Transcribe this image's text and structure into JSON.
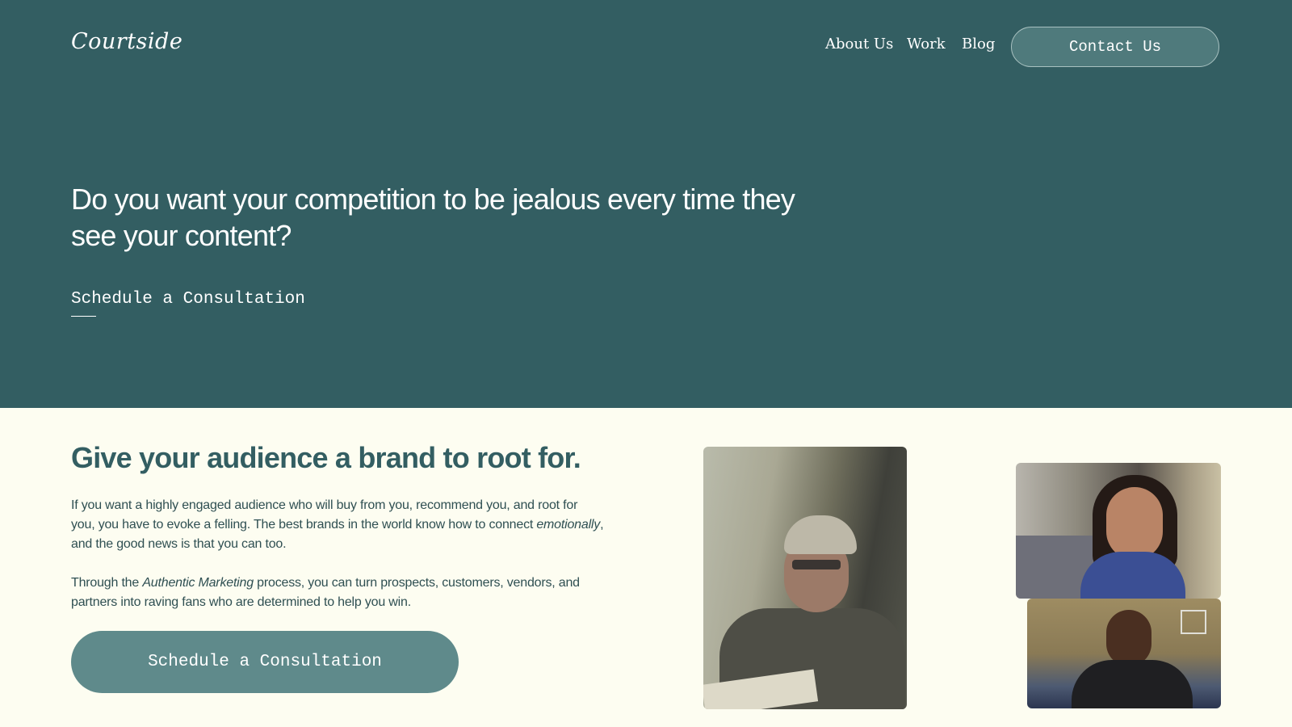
{
  "header": {
    "logo": "Courtside",
    "nav": [
      "About Us",
      "Work",
      "Blog"
    ],
    "contact_label": "Contact Us"
  },
  "hero": {
    "title": "Do you want your competition to be jealous every time they see your content?",
    "cta_label": "Schedule a Consultation"
  },
  "section": {
    "title": "Give your audience a brand to root for.",
    "p1_before": "If you want a highly engaged audience who will buy from you, recommend you, and root for you, you have to evoke a felling. The best brands in the world know how to connect ",
    "p1_em": "emotionally",
    "p1_after": ", and the good news is that you can too.",
    "p2_before": "Through the ",
    "p2_em": "Authentic Marketing",
    "p2_after": " process, you can turn prospects, customers, vendors, and partners into raving fans who are determined to help you win.",
    "cta_label": "Schedule a Consultation"
  },
  "colors": {
    "hero_bg": "#335e62",
    "page_bg": "#fdfdf1",
    "accent": "#5f8a8b",
    "heading": "#335e62"
  }
}
